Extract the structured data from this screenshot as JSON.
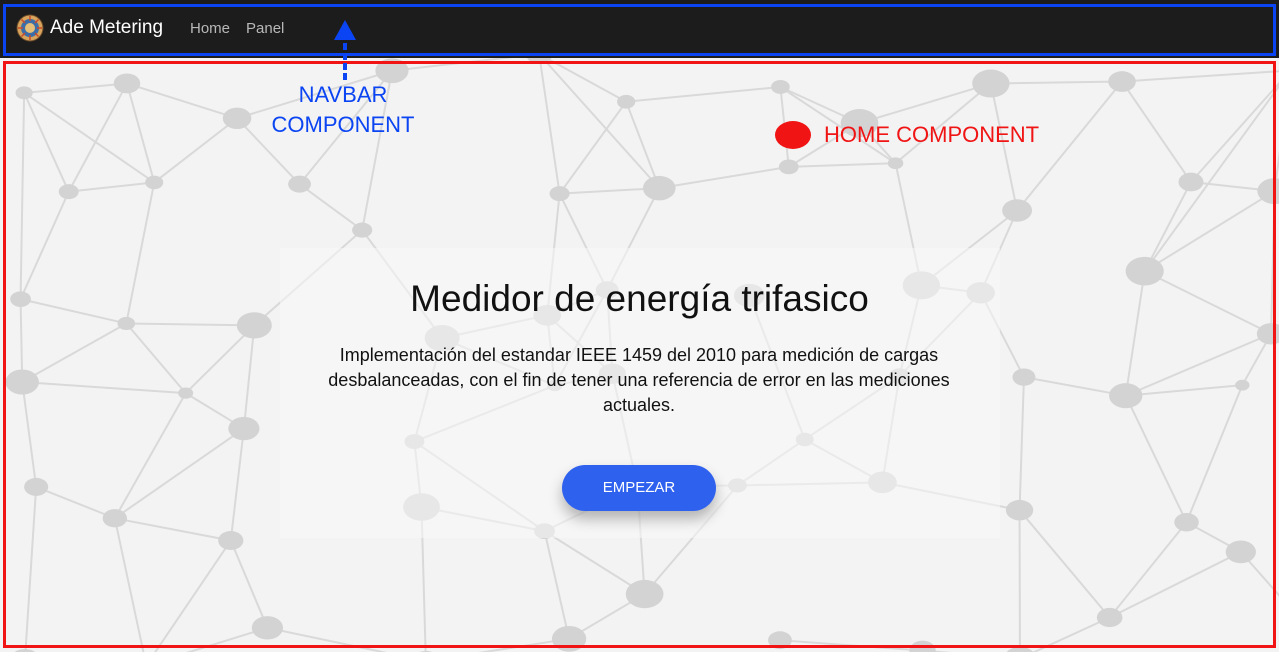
{
  "navbar": {
    "brand": "Ade Metering",
    "links": [
      {
        "label": "Home"
      },
      {
        "label": "Panel"
      }
    ]
  },
  "home": {
    "title": "Medidor de energía trifasico",
    "description": "Implementación del estandar IEEE 1459 del 2010 para medición de cargas desbalanceadas, con el fin de tener una referencia de error en las mediciones actuales.",
    "button_label": "EMPEZAR"
  },
  "annotations": {
    "navbar_label": "NAVBAR\nCOMPONENT",
    "home_label": "HOME COMPONENT"
  },
  "colors": {
    "navbar_bg": "#1c1c1c",
    "button_accent": "#2f61ef",
    "navbar_outline": "#0b44f2",
    "home_outline": "#f01414"
  }
}
